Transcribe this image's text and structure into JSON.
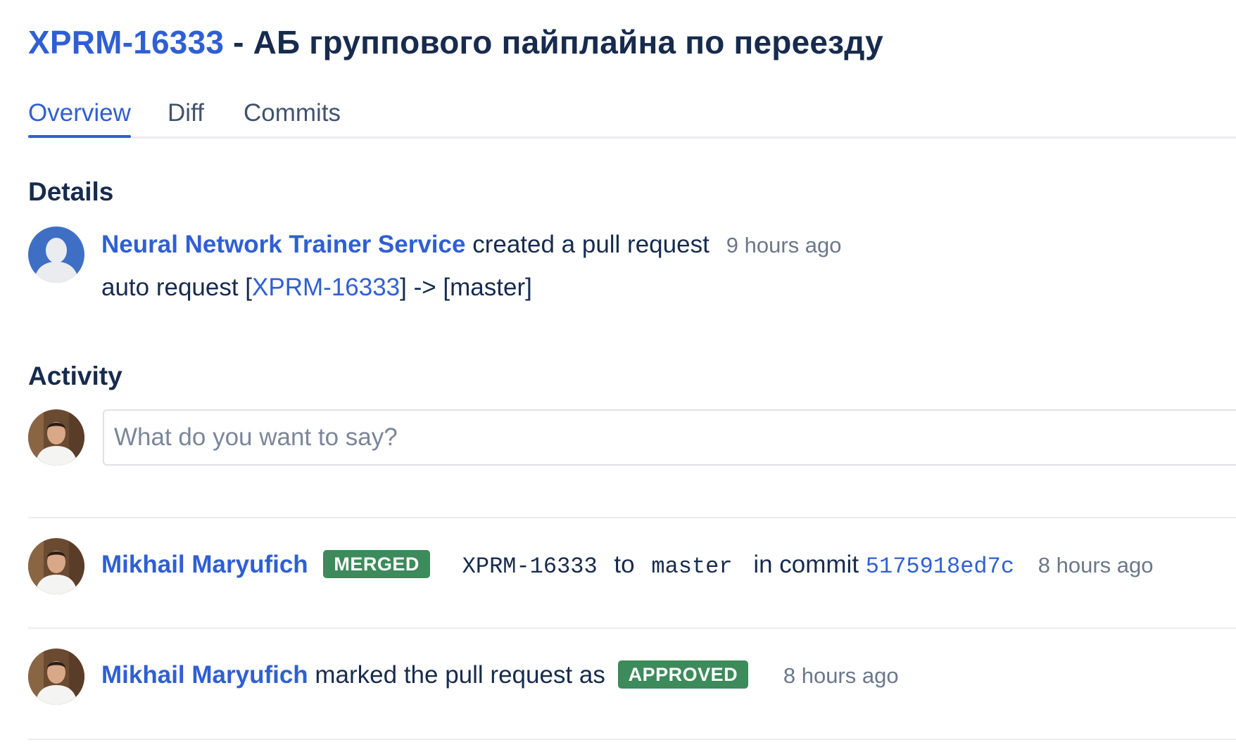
{
  "pull_request": {
    "key": "XPRM-16333",
    "title_rest": " - АБ группового пайплайна по переезду"
  },
  "tabs": [
    {
      "label": "Overview",
      "active": true
    },
    {
      "label": "Diff",
      "active": false
    },
    {
      "label": "Commits",
      "active": false
    }
  ],
  "details": {
    "heading": "Details",
    "author": "Neural Network Trainer Service",
    "action": " created a pull request",
    "time": "9 hours ago",
    "desc_prefix": "auto request [",
    "desc_link": "XPRM-16333",
    "desc_suffix": "] -> [master]"
  },
  "activity": {
    "heading": "Activity",
    "comment_placeholder": "What do you want to say?",
    "events": [
      {
        "user": "Mikhail Maryufich",
        "badge": "MERGED",
        "source_branch": "XPRM-16333",
        "to_text": "to",
        "target_branch": "master",
        "commit_text": "in commit",
        "commit": "5175918ed7c",
        "time": "8 hours ago"
      },
      {
        "user": "Mikhail Maryufich",
        "action": " marked the pull request as ",
        "badge": "APPROVED",
        "time": "8 hours ago"
      }
    ]
  },
  "colors": {
    "link": "#2f5fd3",
    "text": "#172b4d",
    "muted": "#6b778c",
    "badge_green": "#3d8a5b",
    "divider": "#ebecf0"
  },
  "icons": {
    "service_avatar": "default-user-silhouette-icon",
    "user_avatar": "user-photo-avatar"
  }
}
